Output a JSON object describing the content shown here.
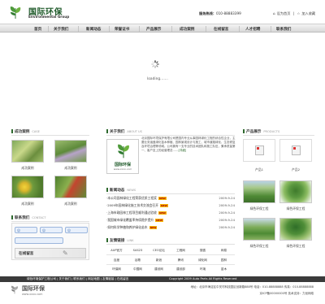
{
  "header": {
    "logo_cn": "国际环保",
    "logo_en": "Environmental Group",
    "hotline_label": "服务热线：",
    "hotline_number": "010-88883399",
    "links": [
      "设为首页",
      "加入收藏"
    ]
  },
  "nav": {
    "items": [
      "首页",
      "关于我们",
      "新闻动态",
      "荣誉证书",
      "产品展示",
      "成功案例",
      "在线留言",
      "人才招聘",
      "联系我们"
    ]
  },
  "loading": {
    "text": "loading......."
  },
  "cases": {
    "title": "成功案例",
    "title_en": "CASE",
    "items": [
      {
        "caption": "成功案例"
      },
      {
        "caption": "成功案例"
      },
      {
        "caption": "成功案例"
      },
      {
        "caption": "成功案例"
      }
    ]
  },
  "contact": {
    "title": "联系我们",
    "title_en": "CONTACT",
    "online_label": "在线留言"
  },
  "about": {
    "title": "关于我们",
    "title_en": "ABOUT US",
    "img_logo_cn": "国际环保",
    "img_logo_url": "www.xxxx.com",
    "text": "北京国际环境保护有限公司是国内专业从事园林绿化工程的综合性企业，主要业务涵盖绿化苗木种植、园林景观设计与施工、城市道路绿化、生态修复及环境治理等领域。公司拥有一支专业的技术团队和施工队伍，秉承质量第一、客户至上的经营理念……",
    "more": "[详细]"
  },
  "news": {
    "title": "新闻动态",
    "title_en": "NEWS",
    "items": [
      {
        "title": "·本公司园林绿化工程荣获优质工程奖",
        "date": "2009-9-24",
        "new": "NEW"
      },
      {
        "title": "·2009年园林绿化施工技术交流会召开",
        "date": "2009-9-24",
        "new": "NEW"
      },
      {
        "title": "·上海市政园林工程项目顺利通过验收",
        "date": "2009-9-24",
        "new": "NEW"
      },
      {
        "title": "·我国城市绿化覆盖率持续稳步提升",
        "date": "2009-9-24",
        "new": "NEW"
      },
      {
        "title": "·如何科学种植和养护绿化苗木",
        "date": "2009-9-24",
        "new": "NEW"
      }
    ]
  },
  "links": {
    "title": "友情链接",
    "title_en": "LINK",
    "rows": [
      [
        "AUP官方",
        "SAS23",
        "CEO论坛",
        "工程网",
        "搜狐",
        "网易"
      ],
      [
        "百度",
        "谷歌",
        "新浪",
        "腾讯",
        "绿化网",
        "园林"
      ],
      [
        "环保网",
        "中国网",
        "建设网",
        "建设部",
        "环境",
        "苗木"
      ]
    ]
  },
  "products": {
    "title": "产品展示",
    "title_en": "PRODUCTS",
    "items": [
      {
        "caption": "产品1"
      },
      {
        "caption": "产品2"
      },
      {
        "caption": "绿色环保工程"
      },
      {
        "caption": "绿色环保工程"
      },
      {
        "caption": "绿色环保工程"
      },
      {
        "caption": "绿色环保工程"
      }
    ]
  },
  "footer": {
    "links": "绿色环境保护工程公司 | 关于我们 | 联系我们 | 网站地图 | 友情链接 | 在线留言",
    "copyright": "Copyright 2009 Auto Parts All Rights Reserved",
    "logo_cn": "国际环保",
    "logo_url": "www.xxxx.com",
    "address": "地址：北京市海淀区中关村科技园区创新路888号  电话：010-88888888  传真：010-88888888",
    "record": "京ICP备00000000号  技术支持：力创网络"
  },
  "colors": {
    "brand_green": "#2f6a2f",
    "footer_bg": "#3a3a3a",
    "nav_bg": "#e6e6e6"
  }
}
